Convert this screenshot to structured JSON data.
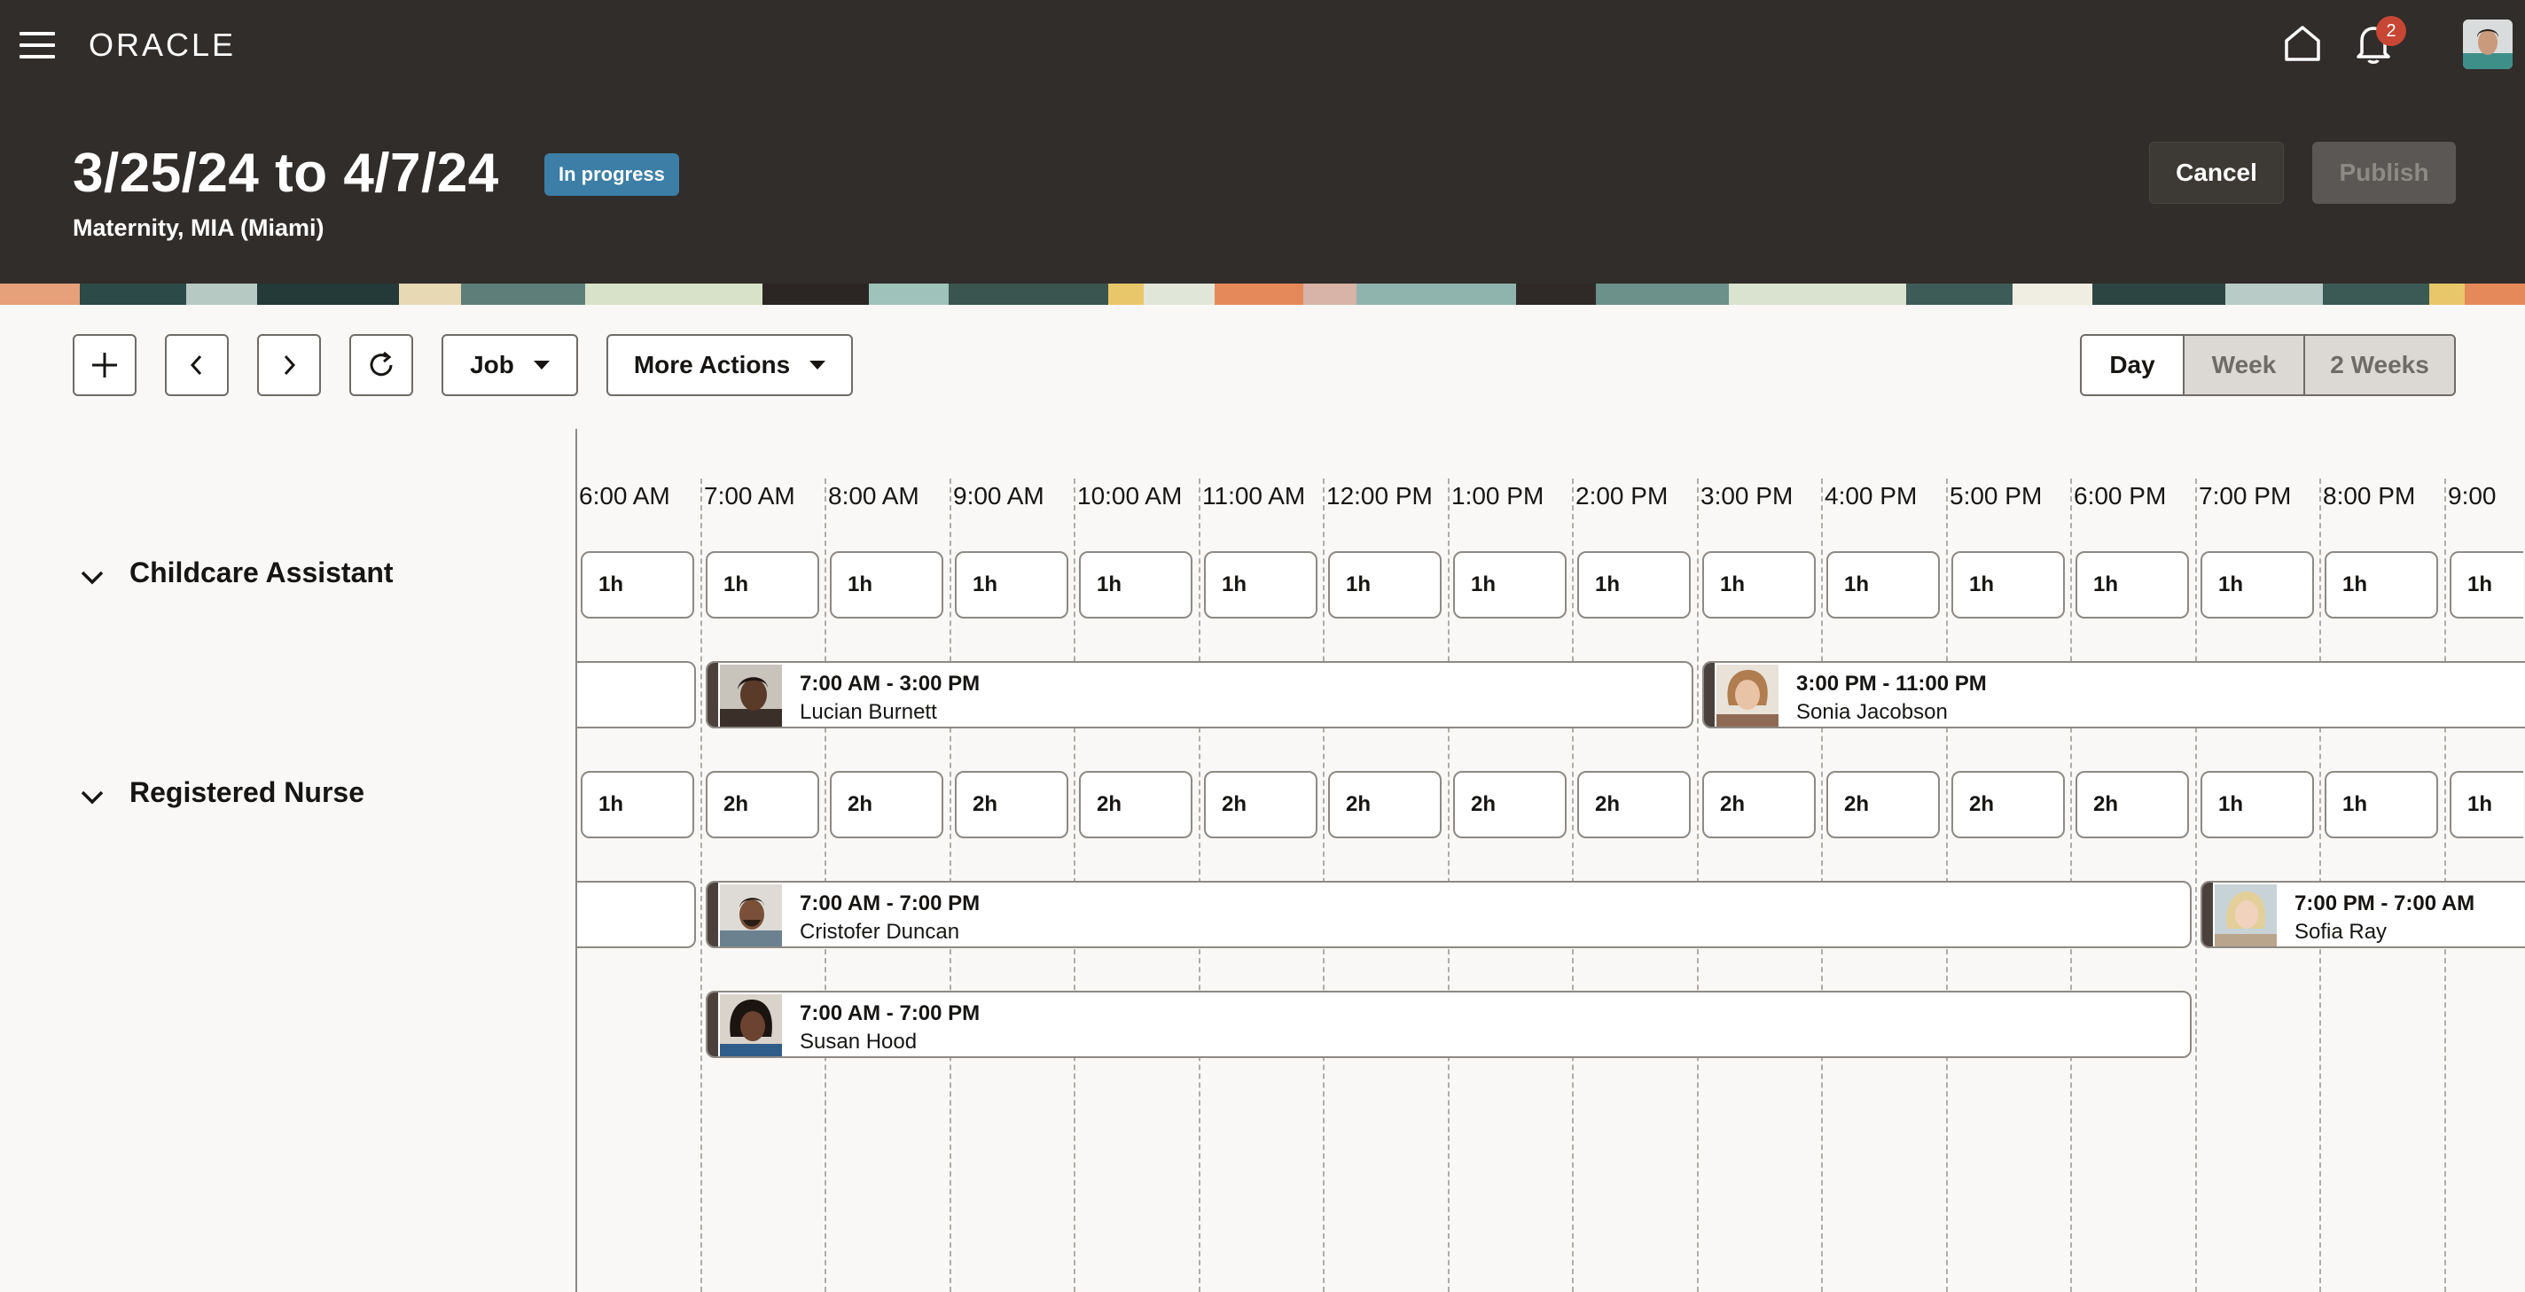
{
  "header": {
    "brand": "ORACLE",
    "notification_count": "2",
    "title": "3/25/24 to 4/7/24",
    "status": "In progress",
    "subtitle": "Maternity, MIA (Miami)",
    "cancel_label": "Cancel",
    "publish_label": "Publish"
  },
  "toolbar": {
    "job_label": "Job",
    "more_actions_label": "More Actions",
    "view_day": "Day",
    "view_week": "Week",
    "view_2weeks": "2 Weeks"
  },
  "timeline": {
    "hours": [
      "6:00 AM",
      "7:00 AM",
      "8:00 AM",
      "9:00 AM",
      "10:00 AM",
      "11:00 AM",
      "12:00 PM",
      "1:00 PM",
      "2:00 PM",
      "3:00 PM",
      "4:00 PM",
      "5:00 PM",
      "6:00 PM",
      "7:00 PM",
      "8:00 PM",
      "9:00"
    ]
  },
  "groups": [
    {
      "name": "Childcare Assistant",
      "coverage": [
        "1h",
        "1h",
        "1h",
        "1h",
        "1h",
        "1h",
        "1h",
        "1h",
        "1h",
        "1h",
        "1h",
        "1h",
        "1h",
        "1h",
        "1h",
        "1h"
      ],
      "shifts": [
        {
          "time": "7:00 AM - 3:00 PM",
          "name": "Lucian Burnett"
        },
        {
          "time": "3:00 PM - 11:00 PM",
          "name": "Sonia Jacobson"
        }
      ]
    },
    {
      "name": "Registered Nurse",
      "coverage": [
        "1h",
        "2h",
        "2h",
        "2h",
        "2h",
        "2h",
        "2h",
        "2h",
        "2h",
        "2h",
        "2h",
        "2h",
        "2h",
        "1h",
        "1h",
        "1h"
      ],
      "shifts": [
        {
          "time": "7:00 AM - 7:00 PM",
          "name": "Cristofer Duncan"
        },
        {
          "time": "7:00 PM - 7:00 AM",
          "name": "Sofia Ray"
        },
        {
          "time": "7:00 AM - 7:00 PM",
          "name": "Susan Hood"
        }
      ]
    }
  ]
}
